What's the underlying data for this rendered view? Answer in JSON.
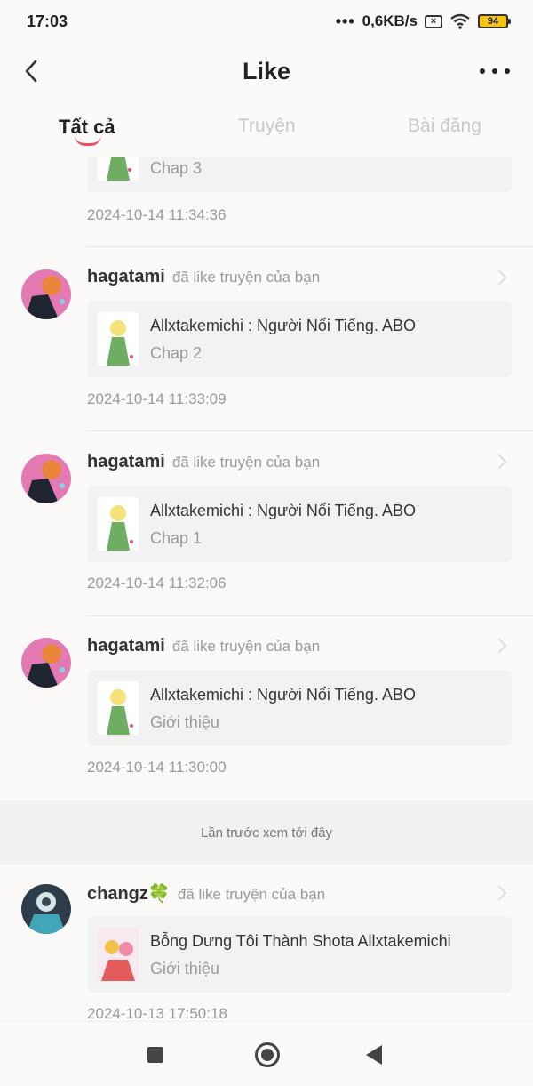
{
  "status_bar": {
    "time": "17:03",
    "network_speed": "0,6KB/s",
    "battery": "94",
    "dots": "•••",
    "sim_icon": "x-icon"
  },
  "header": {
    "title": "Like",
    "back_icon": "chevron-left-icon",
    "more_icon": "more-horizontal-icon"
  },
  "tabs": [
    {
      "label": "Tất cả",
      "active": true
    },
    {
      "label": "Truyện",
      "active": false
    },
    {
      "label": "Bài đăng",
      "active": false
    }
  ],
  "colors": {
    "accent": "#f04b5c",
    "background": "#fbfaf8",
    "card": "#f2f2f2"
  },
  "feed": {
    "partial_item": {
      "chapter": "Chap 3",
      "timestamp": "2024-10-14 11:34:36"
    },
    "items": [
      {
        "username": "hagatami",
        "action": "đã like truyện của bạn",
        "story": "Allxtakemichi : Người Nổi Tiếng. ABO",
        "chapter": "Chap 2",
        "timestamp": "2024-10-14 11:33:09"
      },
      {
        "username": "hagatami",
        "action": "đã like truyện của bạn",
        "story": "Allxtakemichi : Người Nổi Tiếng. ABO",
        "chapter": "Chap 1",
        "timestamp": "2024-10-14 11:32:06"
      },
      {
        "username": "hagatami",
        "action": "đã like truyện của bạn",
        "story": "Allxtakemichi : Người Nổi Tiếng. ABO",
        "chapter": "Giới thiệu",
        "timestamp": "2024-10-14 11:30:00"
      }
    ],
    "last_seen_label": "Lần trước xem tới đây",
    "older_items": [
      {
        "username": "changz🍀",
        "action": "đã like truyện của bạn",
        "story": "Bỗng Dưng Tôi Thành Shota Allxtakemichi",
        "chapter": "Giới thiệu",
        "timestamp": "2024-10-13 17:50:18"
      }
    ]
  },
  "nav_bar": {
    "recent_icon": "square-icon",
    "home_icon": "circle-home-icon",
    "back_icon": "triangle-back-icon"
  }
}
